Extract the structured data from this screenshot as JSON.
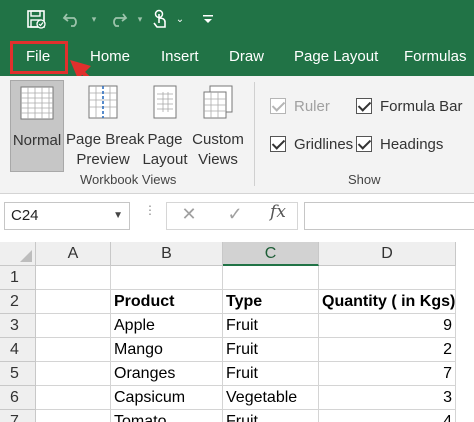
{
  "colors": {
    "accent": "#217346",
    "highlight": "#e0302d",
    "ribbon_bg": "#f3f3f3"
  },
  "qat": {
    "icons": [
      "save-icon",
      "undo-icon",
      "redo-icon",
      "touch-mode-icon",
      "customize-icon"
    ]
  },
  "tabs": [
    "File",
    "Home",
    "Insert",
    "Draw",
    "Page Layout",
    "Formulas"
  ],
  "ribbon": {
    "workbook_views": {
      "buttons": [
        {
          "line1": "Normal",
          "line2": "",
          "selected": true,
          "icon": "normal-view-icon"
        },
        {
          "line1": "Page Break",
          "line2": "Preview",
          "selected": false,
          "icon": "page-break-preview-icon"
        },
        {
          "line1": "Page",
          "line2": "Layout",
          "selected": false,
          "icon": "page-layout-icon"
        },
        {
          "line1": "Custom",
          "line2": "Views",
          "selected": false,
          "icon": "custom-views-icon"
        }
      ],
      "label": "Workbook Views"
    },
    "show": {
      "label": "Show",
      "ruler": {
        "label": "Ruler",
        "checked": true,
        "disabled": true
      },
      "gridlines": {
        "label": "Gridlines",
        "checked": true,
        "disabled": false
      },
      "formula_bar": {
        "label": "Formula Bar",
        "checked": true,
        "disabled": false
      },
      "headings": {
        "label": "Headings",
        "checked": true,
        "disabled": false
      }
    }
  },
  "formula_bar": {
    "name_box": "C24",
    "cancel": "✕",
    "enter": "✓",
    "fx": "fx",
    "value": ""
  },
  "sheet": {
    "columns": [
      "A",
      "B",
      "C",
      "D"
    ],
    "selected_column": "C",
    "rows": [
      {
        "num": "1",
        "a": "",
        "b": "",
        "c": "",
        "d": ""
      },
      {
        "num": "2",
        "a": "",
        "b": "Product",
        "c": "Type",
        "d": "Quantity ( in Kgs)"
      },
      {
        "num": "3",
        "a": "",
        "b": "Apple",
        "c": "Fruit",
        "d": "9"
      },
      {
        "num": "4",
        "a": "",
        "b": "Mango",
        "c": "Fruit",
        "d": "2"
      },
      {
        "num": "5",
        "a": "",
        "b": "Oranges",
        "c": "Fruit",
        "d": "7"
      },
      {
        "num": "6",
        "a": "",
        "b": "Capsicum",
        "c": "Vegetable",
        "d": "3"
      },
      {
        "num": "7",
        "a": "",
        "b": "Tomato",
        "c": "Fruit",
        "d": "4"
      }
    ]
  }
}
